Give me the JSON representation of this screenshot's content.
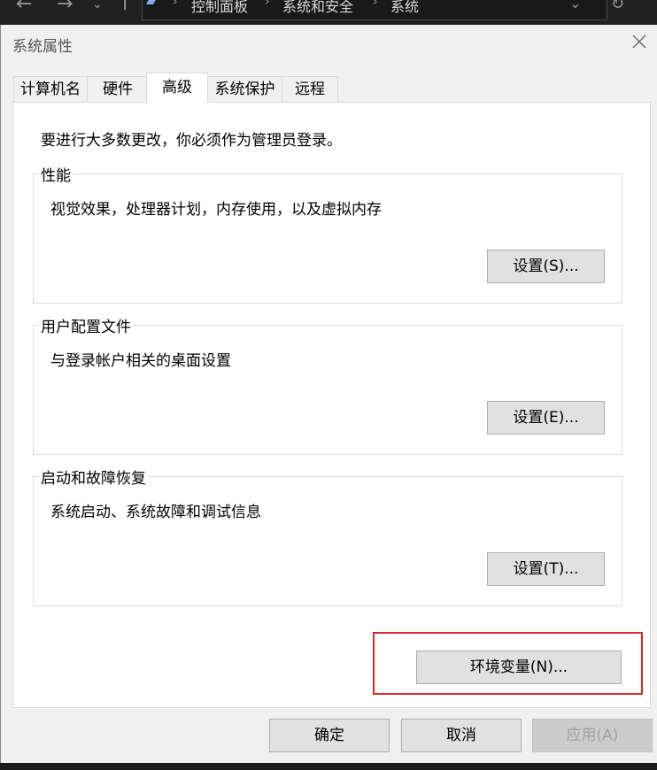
{
  "explorer": {
    "breadcrumbs": [
      "控制面板",
      "系统和安全",
      "系统"
    ]
  },
  "dialog": {
    "title": "系统属性",
    "tabs": [
      {
        "label": "计算机名",
        "active": false
      },
      {
        "label": "硬件",
        "active": false
      },
      {
        "label": "高级",
        "active": true
      },
      {
        "label": "系统保护",
        "active": false
      },
      {
        "label": "远程",
        "active": false
      }
    ],
    "notice": "要进行大多数更改，你必须作为管理员登录。",
    "groups": [
      {
        "label": "性能",
        "description": "视觉效果，处理器计划，内存使用，以及虚拟内存",
        "button": "设置(S)..."
      },
      {
        "label": "用户配置文件",
        "description": "与登录帐户相关的桌面设置",
        "button": "设置(E)..."
      },
      {
        "label": "启动和故障恢复",
        "description": "系统启动、系统故障和调试信息",
        "button": "设置(T)..."
      }
    ],
    "env_button": "环境变量(N)...",
    "footer": {
      "ok": "确定",
      "cancel": "取消",
      "apply": "应用(A)"
    }
  },
  "colors": {
    "highlight": "#e0262a",
    "dialog_bg": "#f0f0f0",
    "button_bg": "#e1e1e1"
  }
}
